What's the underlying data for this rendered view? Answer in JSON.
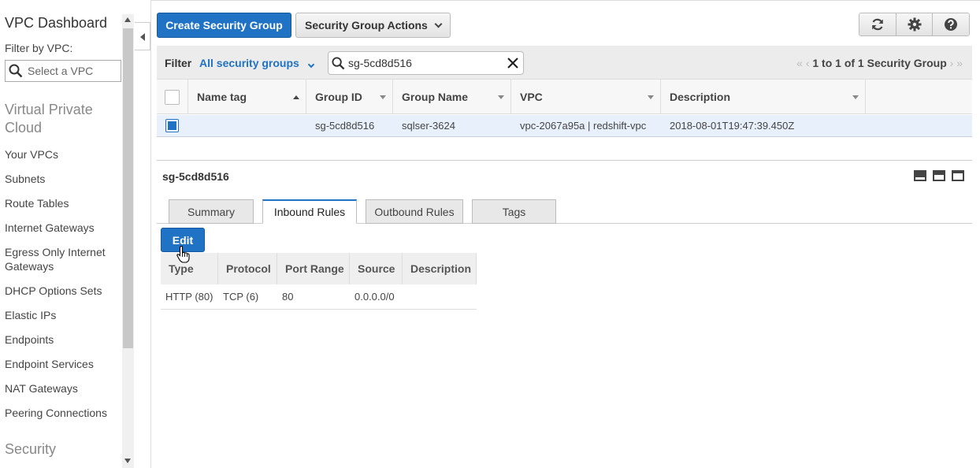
{
  "sidebar": {
    "title": "VPC Dashboard",
    "filter_label": "Filter by VPC:",
    "select_placeholder": "Select a VPC",
    "section_vpc": "Virtual Private Cloud",
    "items": [
      "Your VPCs",
      "Subnets",
      "Route Tables",
      "Internet Gateways",
      "Egress Only Internet Gateways",
      "DHCP Options Sets",
      "Elastic IPs",
      "Endpoints",
      "Endpoint Services",
      "NAT Gateways",
      "Peering Connections"
    ],
    "section_security": "Security"
  },
  "toolbar": {
    "create_label": "Create Security Group",
    "actions_label": "Security Group Actions",
    "icons": [
      "refresh-icon",
      "gear-icon",
      "help-icon"
    ]
  },
  "filter": {
    "label": "Filter",
    "dropdown_value": "All security groups",
    "search_value": "sg-5cd8d516",
    "pager_text": "1 to 1 of 1 Security Group"
  },
  "grid": {
    "columns": [
      "Name tag",
      "Group ID",
      "Group Name",
      "VPC",
      "Description"
    ],
    "rows": [
      {
        "name_tag": "",
        "group_id": "sg-5cd8d516",
        "group_name": "sqlser-3624",
        "vpc": "vpc-2067a95a | redshift-vpc",
        "description": "2018-08-01T19:47:39.450Z",
        "selected": true
      }
    ]
  },
  "details": {
    "title": "sg-5cd8d516",
    "tabs": [
      "Summary",
      "Inbound Rules",
      "Outbound Rules",
      "Tags"
    ],
    "active_tab": "Inbound Rules",
    "edit_label": "Edit",
    "rules_columns": [
      "Type",
      "Protocol",
      "Port Range",
      "Source",
      "Description"
    ],
    "rules": [
      {
        "type": "HTTP (80)",
        "protocol": "TCP (6)",
        "port_range": "80",
        "source": "0.0.0.0/0",
        "description": ""
      }
    ]
  },
  "colors": {
    "primary": "#1f72c4",
    "selected_row": "#e8f1fb"
  }
}
